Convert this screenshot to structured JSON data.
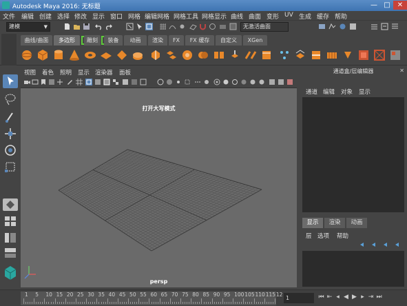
{
  "window": {
    "title": "Autodesk Maya 2016: 无标题",
    "buttons": [
      "—",
      "□",
      "✕"
    ]
  },
  "menubar": [
    "文件",
    "编辑",
    "创建",
    "选择",
    "修改",
    "显示",
    "窗口",
    "网格",
    "编辑网格",
    "网格工具",
    "网格显示",
    "曲线",
    "曲面",
    "变形",
    "UV",
    "生成",
    "缓存",
    "帮助"
  ],
  "statusline": {
    "mode": "建模",
    "live_surface": "无激活曲面"
  },
  "shelf": {
    "tabs": [
      "曲线/曲面",
      "多边形",
      "雕刻",
      "装备",
      "动画",
      "渲染",
      "FX",
      "FX 缓存",
      "自定义",
      "XGen"
    ],
    "active_tab": "多边形",
    "icon_color": "#e8882a"
  },
  "viewport": {
    "menus": [
      "视图",
      "着色",
      "照明",
      "显示",
      "渲染器",
      "面板"
    ],
    "caption": "打开大写模式",
    "camera": "persp"
  },
  "channel_box": {
    "title": "通道盒/层编辑器",
    "menus": [
      "通道",
      "编辑",
      "对象",
      "显示"
    ]
  },
  "layer_editor": {
    "tabs": [
      "显示",
      "渲染",
      "动画"
    ],
    "active_tab": "显示",
    "menus": [
      "层",
      "选项",
      "帮助"
    ]
  },
  "timeslider": {
    "labels": [
      "1",
      "5",
      "10",
      "15",
      "20",
      "25",
      "30",
      "35",
      "40",
      "45",
      "50",
      "55",
      "60",
      "65",
      "70",
      "75",
      "80",
      "85",
      "90",
      "95",
      "100",
      "105",
      "110",
      "115",
      "12"
    ],
    "current_frame": "1"
  }
}
